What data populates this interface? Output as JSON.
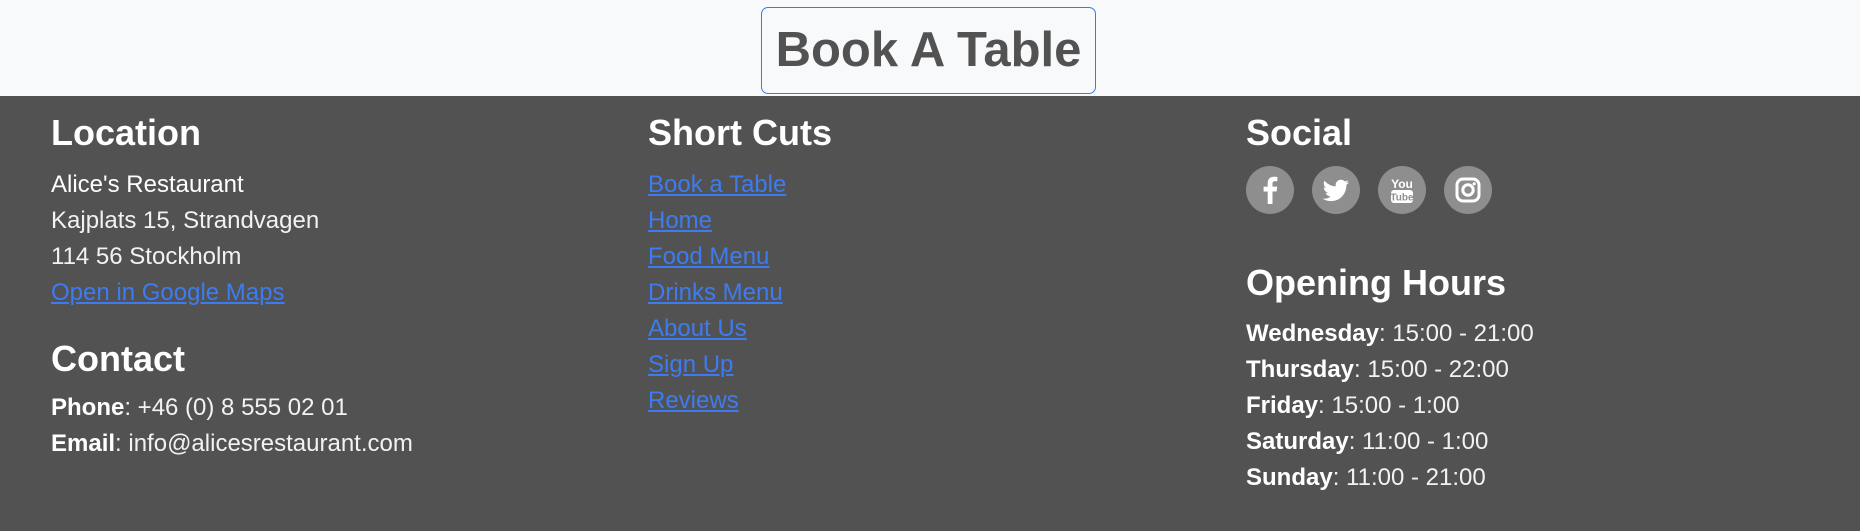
{
  "book_button": {
    "label": "Book A Table"
  },
  "location": {
    "heading": "Location",
    "name": "Alice's Restaurant",
    "street": "Kajplats 15, Strandvagen",
    "city": "114 56 Stockholm",
    "maps_link": "Open in Google Maps"
  },
  "contact": {
    "heading": "Contact",
    "phone_label": "Phone",
    "phone_value": ": +46 (0) 8 555 02 01",
    "email_label": "Email",
    "email_value": ": info@alicesrestaurant.com"
  },
  "shortcuts": {
    "heading": "Short Cuts",
    "links": [
      "Book a Table",
      "Home",
      "Food Menu",
      "Drinks Menu",
      "About Us",
      "Sign Up",
      "Reviews"
    ]
  },
  "social": {
    "heading": "Social",
    "icons": [
      "facebook-icon",
      "twitter-icon",
      "youtube-icon",
      "instagram-icon"
    ]
  },
  "hours": {
    "heading": "Opening Hours",
    "days": [
      {
        "day": "Wednesday",
        "time": ": 15:00 - 21:00"
      },
      {
        "day": "Thursday",
        "time": ": 15:00 - 22:00"
      },
      {
        "day": "Friday",
        "time": ": 15:00 - 1:00"
      },
      {
        "day": "Saturday",
        "time": ": 11:00 - 1:00"
      },
      {
        "day": "Sunday",
        "time": ": 11:00 - 21:00"
      }
    ]
  },
  "colors": {
    "footer_bg": "#525252",
    "top_bg": "#f8f9fb",
    "link": "#3d7cf0",
    "button_border": "#3b7be0",
    "social_circle": "#8e8e8e"
  }
}
